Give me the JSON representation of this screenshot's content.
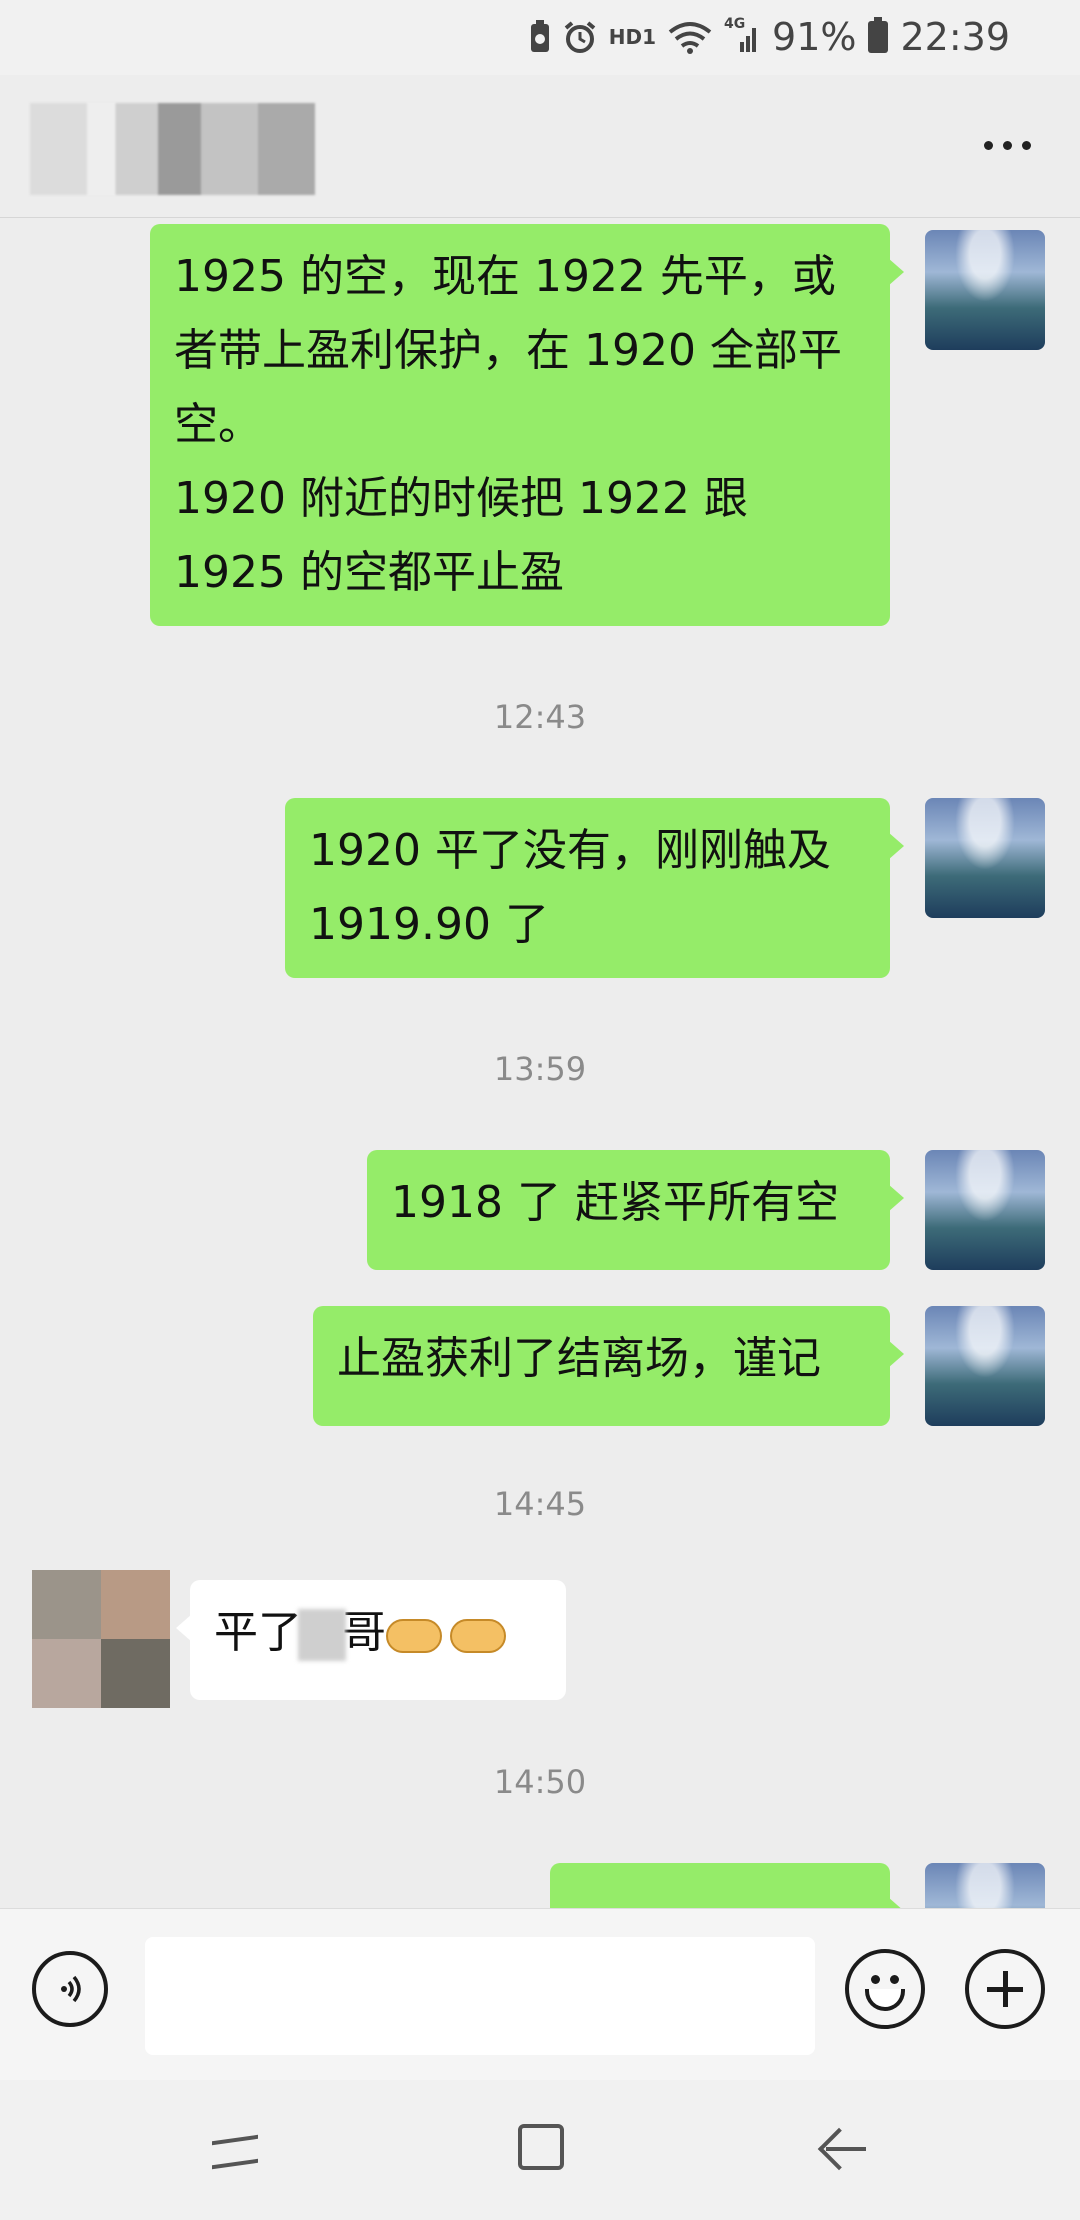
{
  "status_bar": {
    "hd_label": "HD1",
    "network_label": "4G",
    "battery": "91%",
    "time": "22:39"
  },
  "header": {
    "contact_name": "",
    "more_icon": "more-dots-icon"
  },
  "messages": [
    {
      "sender": "me",
      "text": "1925 的空，现在 1922 先平，或者带上盈利保护，在 1920 全部平空。\n1920 附近的时候把 1922 跟 1925 的空都平止盈"
    },
    {
      "timestamp": "12:43"
    },
    {
      "sender": "me",
      "text": "1920 平了没有，刚刚触及 1919.90 了"
    },
    {
      "timestamp": "13:59"
    },
    {
      "sender": "me",
      "text": "1918 了 赶紧平所有空"
    },
    {
      "sender": "me",
      "text": "止盈获利了结离场，谨记"
    },
    {
      "timestamp": "14:45"
    },
    {
      "sender": "other",
      "text_before": "平了",
      "text_blurred": "哥",
      "text_after": "哥",
      "emojis": [
        "handshake-emoji",
        "handshake-emoji"
      ]
    },
    {
      "timestamp": "14:50"
    },
    {
      "sender": "me",
      "text": "",
      "partial": true
    }
  ],
  "input_bar": {
    "voice_icon": "voice-icon",
    "emoji_icon": "emoji-icon",
    "plus_icon": "plus-icon",
    "input_value": ""
  },
  "nav_bar": {
    "recent_icon": "recent-apps-icon",
    "home_icon": "home-icon",
    "back_icon": "back-icon"
  }
}
